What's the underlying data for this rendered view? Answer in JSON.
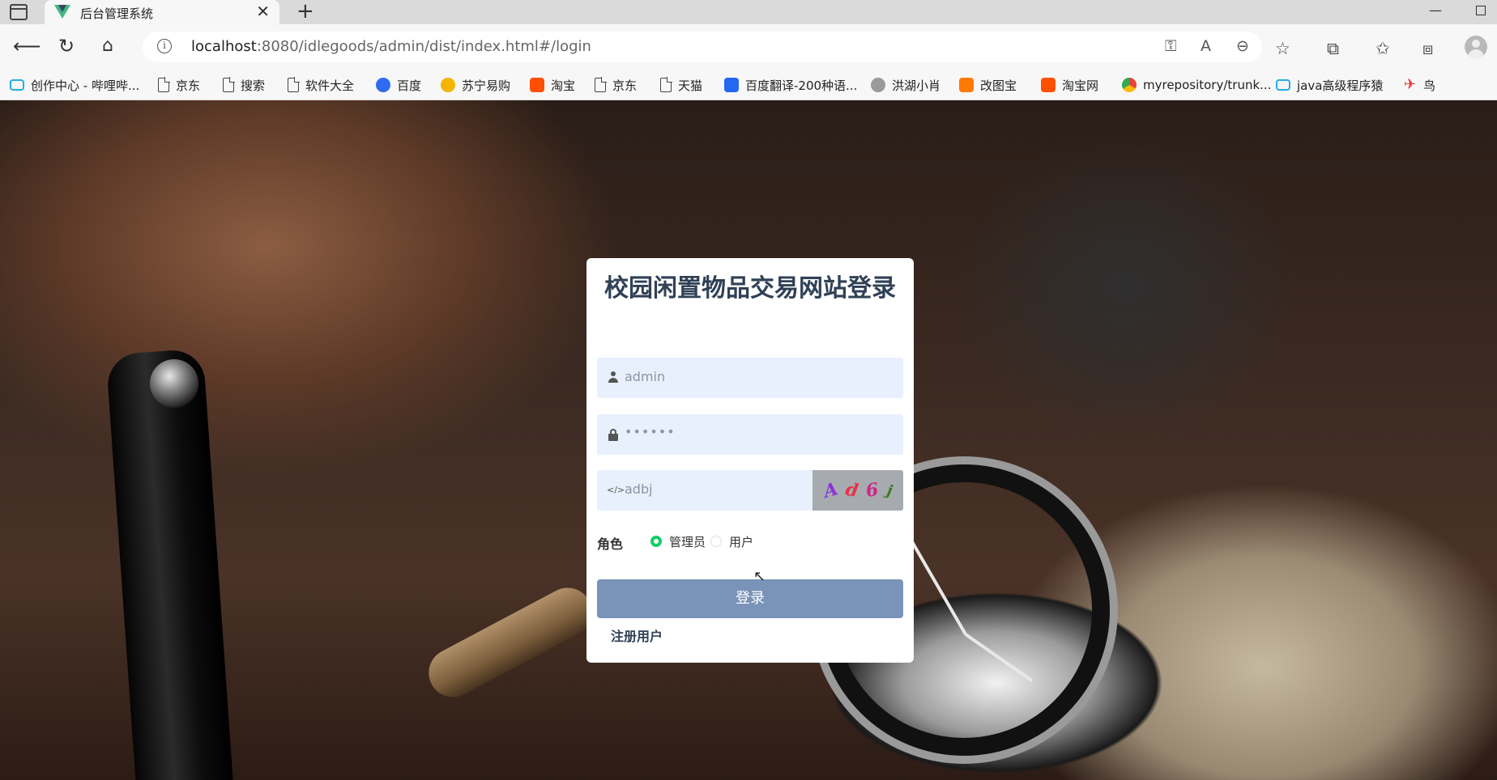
{
  "browser": {
    "tab_title": "后台管理系统",
    "url_host": "localhost",
    "url_rest": ":8080/idlegoods/admin/dist/index.html#/login",
    "new_tab_symbol": "+",
    "tab_close_symbol": "✕"
  },
  "bookmarks": [
    {
      "label": "创作中心 - 哔哩哔...",
      "icon": "bilibili-icon"
    },
    {
      "label": "京东",
      "icon": "page-icon"
    },
    {
      "label": "搜索",
      "icon": "page-icon"
    },
    {
      "label": "软件大全",
      "icon": "page-icon"
    },
    {
      "label": "百度",
      "icon": "baidu-icon"
    },
    {
      "label": "苏宁易购",
      "icon": "suning-icon"
    },
    {
      "label": "淘宝",
      "icon": "taobao-icon"
    },
    {
      "label": "京东",
      "icon": "page-icon"
    },
    {
      "label": "天猫",
      "icon": "page-icon"
    },
    {
      "label": "百度翻译-200种语...",
      "icon": "translate-icon"
    },
    {
      "label": "洪湖小肖",
      "icon": "avatar-icon"
    },
    {
      "label": "改图宝",
      "icon": "gaitubao-icon"
    },
    {
      "label": "淘宝网",
      "icon": "taobao-icon"
    },
    {
      "label": "myrepository/trunk...",
      "icon": "chrome-icon"
    },
    {
      "label": "java高级程序猿",
      "icon": "bilibili-icon"
    },
    {
      "label": "鸟",
      "icon": "bird-icon"
    }
  ],
  "login": {
    "title": "校园闲置物品交易网站登录",
    "username_value": "admin",
    "password_value": "••••••",
    "captcha_value": "adbj",
    "captcha_chars": [
      "A",
      "d",
      "6",
      "j"
    ],
    "role_label": "角色",
    "role_options": [
      "管理员",
      "用户"
    ],
    "role_selected": "管理员",
    "login_button": "登录",
    "register_link": "注册用户"
  },
  "colors": {
    "title": "#304156",
    "field_bg": "#e8f0fe",
    "login_button": "#7a93b9",
    "radio_selected": "#13ce66",
    "captcha_bg": "#a7abaf"
  }
}
